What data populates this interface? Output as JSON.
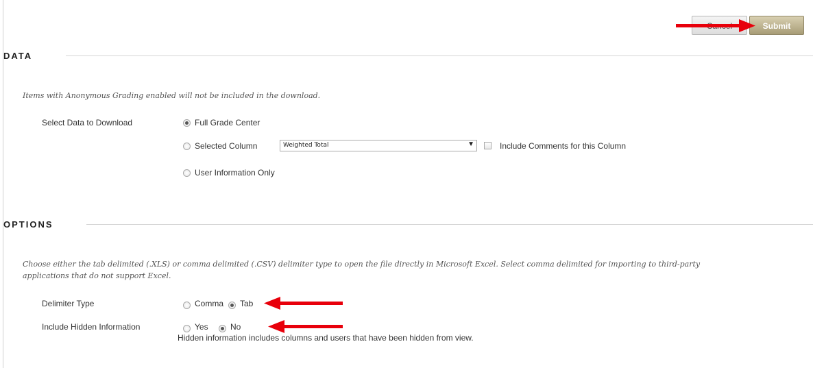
{
  "buttons": {
    "cancel_label": "Cancel",
    "submit_label": "Submit"
  },
  "data_section": {
    "title": "DATA",
    "instructions": "Items with Anonymous Grading enabled will not be included in the download.",
    "select_label": "Select Data to Download",
    "options": {
      "full": {
        "label": "Full Grade Center",
        "checked": true
      },
      "selected_column": {
        "label": "Selected Column",
        "checked": false
      },
      "user_info": {
        "label": "User Information Only",
        "checked": false
      }
    },
    "column_select_value": "Weighted Total",
    "include_comments_label": "Include Comments for this Column",
    "include_comments_checked": false
  },
  "options_section": {
    "title": "OPTIONS",
    "instructions_line1": "Choose either the tab delimited (.XLS) or comma delimited (.CSV) delimiter type to open the file directly in Microsoft Excel. Select comma delimited for importing to third-party",
    "instructions_line2": "applications that do not support Excel.",
    "delimiter_label": "Delimiter Type",
    "delimiter_options": {
      "comma": {
        "label": "Comma",
        "checked": false
      },
      "tab": {
        "label": "Tab",
        "checked": true
      }
    },
    "hidden_label": "Include Hidden Information",
    "hidden_options": {
      "yes": {
        "label": "Yes",
        "checked": false
      },
      "no": {
        "label": "No",
        "checked": true
      }
    },
    "hidden_help": "Hidden information includes columns and users that have been hidden from view."
  },
  "annotations": {
    "arrow_color": "#e8000b"
  },
  "colors": {
    "submit_bg": "#a79c76",
    "cancel_bg": "#dddddd",
    "rule": "#d3d3d3"
  }
}
